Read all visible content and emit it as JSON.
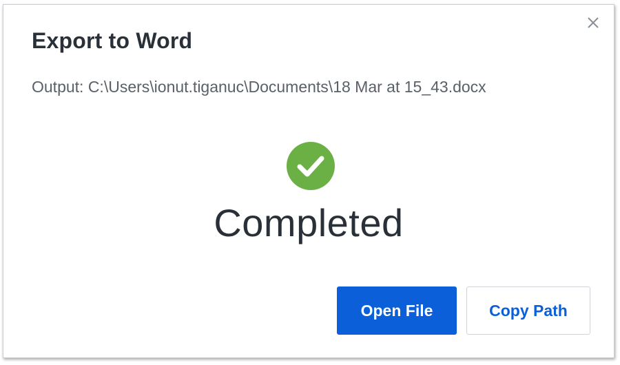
{
  "dialog": {
    "title": "Export to Word",
    "output_path": "Output: C:\\Users\\ionut.tiganuc\\Documents\\18 Mar at 15_43.docx",
    "status": "Completed",
    "status_icon": "check-circle-icon",
    "close_icon": "close-icon",
    "primary_button": "Open File",
    "secondary_button": "Copy Path"
  },
  "colors": {
    "success": "#6ab045",
    "primary": "#0b5fd8",
    "text": "#2a3038",
    "muted": "#5a6068"
  }
}
